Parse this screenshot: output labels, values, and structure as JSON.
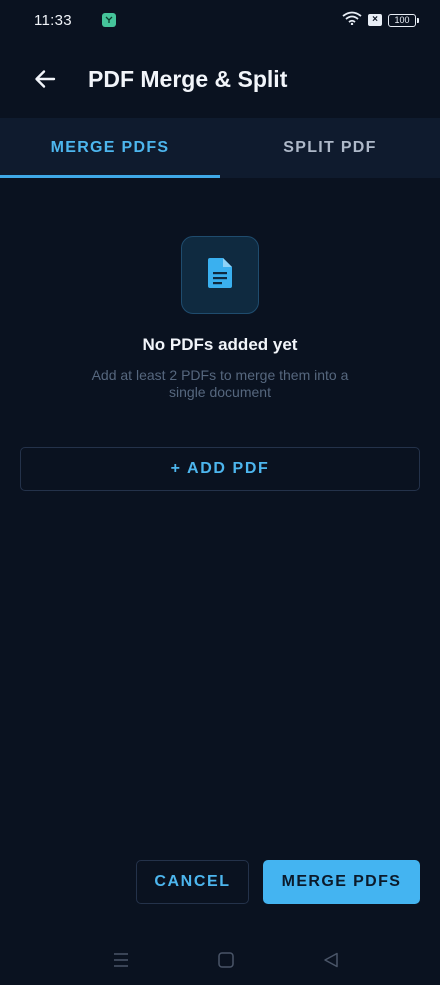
{
  "status_bar": {
    "time": "11:33",
    "battery": "100",
    "icons": [
      "app-notification-icon",
      "wifi-icon",
      "sim-x-icon",
      "battery-icon"
    ]
  },
  "app_bar": {
    "title": "PDF Merge & Split",
    "back_icon": "arrow-left-icon"
  },
  "tabs": [
    {
      "label": "MERGE PDFS",
      "active": true
    },
    {
      "label": "SPLIT PDF",
      "active": false
    }
  ],
  "empty_state": {
    "icon": "document-icon",
    "title": "No PDFs added yet",
    "subtitle": "Add at least 2 PDFs to merge them into a single document"
  },
  "add_pdf_label": "+ ADD PDF",
  "actions": {
    "cancel_label": "CANCEL",
    "merge_label": "MERGE PDFS"
  },
  "nav_bar": {
    "icons": [
      "menu-icon",
      "home-icon",
      "back-triangle-icon"
    ]
  },
  "colors": {
    "background": "#0a1220",
    "accent": "#44b4f1",
    "tab_background": "#0f1b2e"
  }
}
